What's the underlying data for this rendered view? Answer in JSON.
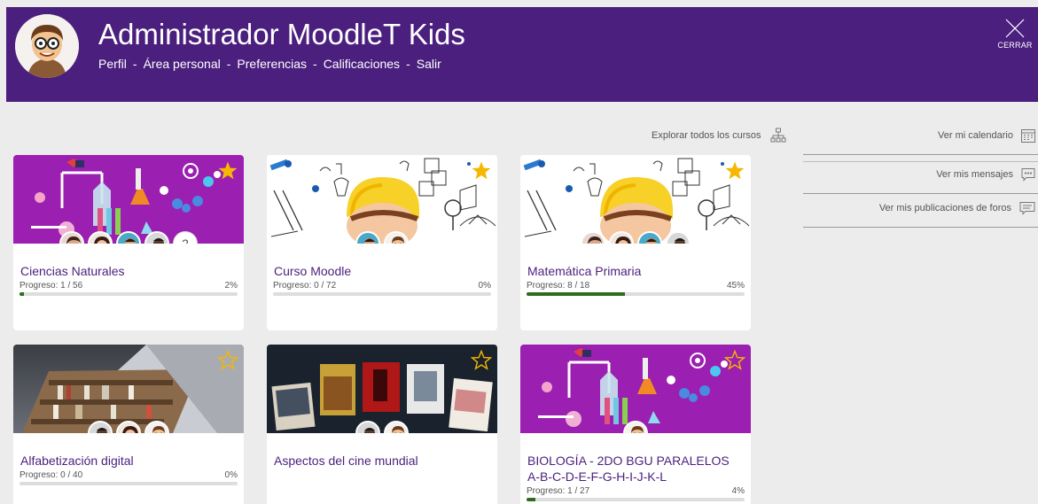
{
  "header": {
    "user_name": "Administrador MoodleT Kids",
    "nav": [
      "Perfil",
      "Área personal",
      "Preferencias",
      "Calificaciones",
      "Salir"
    ],
    "separator": "-",
    "close_label": "CERRAR",
    "bg_color": "#4b1f7d"
  },
  "explore_label": "Explorar todos los cursos",
  "sidebar": {
    "calendar": "Ver mi calendario",
    "messages": "Ver mis mensajes",
    "forums": "Ver mis publicaciones de foros"
  },
  "progress_prefix": "Progreso:",
  "courses": [
    {
      "title": "Ciencias Naturales",
      "progress": "1 / 56",
      "percent": "2%",
      "fraction": 0.02,
      "starred": true,
      "banner": "science",
      "extra_count": "2"
    },
    {
      "title": "Curso Moodle",
      "progress": "0 / 72",
      "percent": "0%",
      "fraction": 0.0,
      "starred": true,
      "banner": "kid"
    },
    {
      "title": "Matemática Primaria",
      "progress": "8 / 18",
      "percent": "45%",
      "fraction": 0.45,
      "starred": true,
      "banner": "kid"
    },
    {
      "title": "Alfabetización digital",
      "progress": "0 / 40",
      "percent": "0%",
      "fraction": 0.0,
      "starred": false,
      "banner": "library"
    },
    {
      "title": "Aspectos del cine mundial",
      "progress": "",
      "percent": "",
      "fraction": null,
      "starred": false,
      "banner": "cinema"
    },
    {
      "title": "BIOLOGÍA - 2DO BGU PARALELOS A-B-C-D-E-F-G-H-I-J-K-L",
      "progress": "1 / 27",
      "percent": "4%",
      "fraction": 0.04,
      "starred": false,
      "banner": "science"
    }
  ],
  "colors": {
    "accent": "#4b1f7d",
    "progress": "#2e6b1f",
    "star": "#f5b700",
    "science_bg": "#9b1fb0"
  }
}
